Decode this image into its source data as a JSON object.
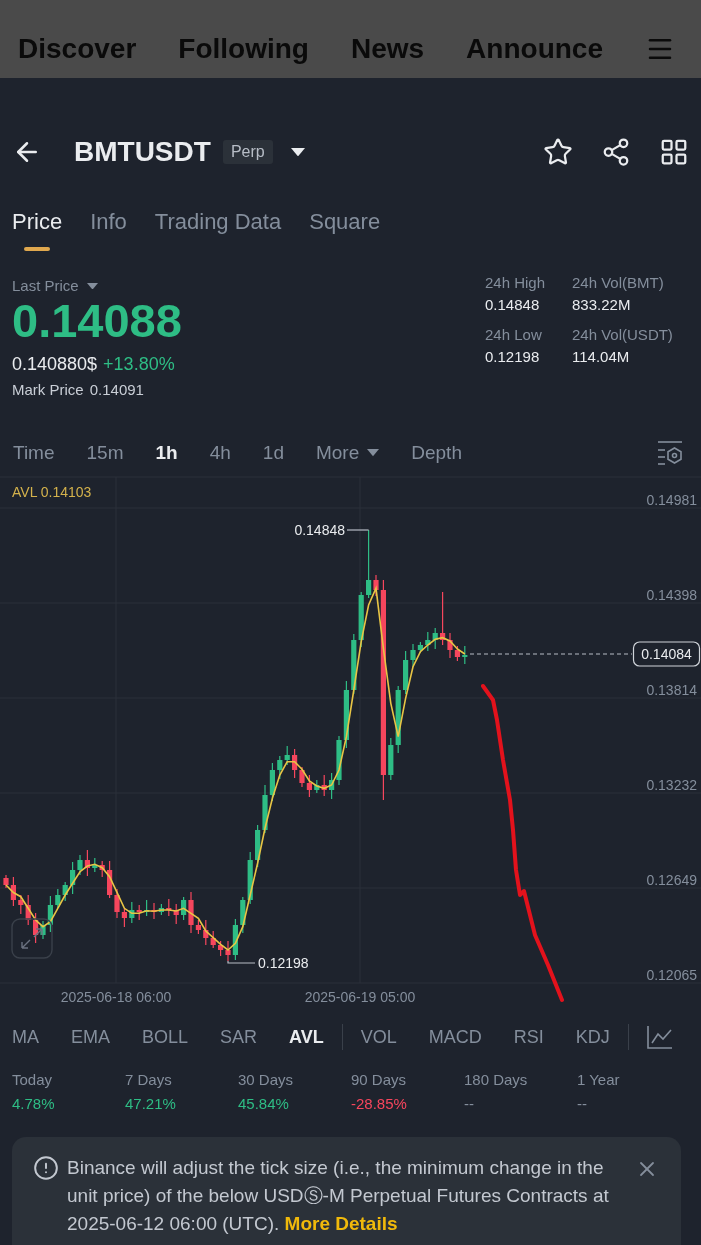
{
  "background_tabs": [
    {
      "label": "Discover"
    },
    {
      "label": "Following"
    },
    {
      "label": "News"
    },
    {
      "label": "Announce"
    }
  ],
  "header": {
    "symbol": "BMTUSDT",
    "badge": "Perp"
  },
  "tabs": [
    {
      "label": "Price",
      "selected": true
    },
    {
      "label": "Info",
      "selected": false
    },
    {
      "label": "Trading Data",
      "selected": false
    },
    {
      "label": "Square",
      "selected": false
    }
  ],
  "price_summary": {
    "last_price_label": "Last Price",
    "last_price": "0.14088",
    "usd_price": "0.140880$",
    "change": "+13.80%",
    "mark_price_label": "Mark Price",
    "mark_price": "0.14091"
  },
  "stats": [
    {
      "label": "24h High",
      "value": "0.14848"
    },
    {
      "label": "24h Vol(BMT)",
      "value": "833.22M"
    },
    {
      "label": "24h Low",
      "value": "0.12198"
    },
    {
      "label": "24h Vol(USDT)",
      "value": "114.04M"
    }
  ],
  "intervals": [
    {
      "label": "Time",
      "kind": "option",
      "selected": false
    },
    {
      "label": "15m",
      "kind": "option",
      "selected": false
    },
    {
      "label": "1h",
      "kind": "option",
      "selected": true
    },
    {
      "label": "4h",
      "kind": "option",
      "selected": false
    },
    {
      "label": "1d",
      "kind": "option",
      "selected": false
    },
    {
      "label": "More",
      "kind": "dropdown",
      "selected": false
    },
    {
      "label": "Depth",
      "kind": "option",
      "selected": false
    }
  ],
  "chart": {
    "indicator_value": "AVL 0.14103",
    "price_ticks": [
      "0.14981",
      "0.14398",
      "0.13814",
      "0.13232",
      "0.12649",
      "0.12065"
    ],
    "time_labels": [
      "2025-06-18 06:00",
      "2025-06-19 05:00"
    ],
    "high_marker": "0.14848",
    "low_marker": "0.12198",
    "current_price": "0.14084"
  },
  "main_indicators": [
    {
      "label": "MA",
      "selected": false
    },
    {
      "label": "EMA",
      "selected": false
    },
    {
      "label": "BOLL",
      "selected": false
    },
    {
      "label": "SAR",
      "selected": false
    },
    {
      "label": "AVL",
      "selected": true
    }
  ],
  "sub_indicators": [
    {
      "label": "VOL",
      "selected": false
    },
    {
      "label": "MACD",
      "selected": false
    },
    {
      "label": "RSI",
      "selected": false
    },
    {
      "label": "KDJ",
      "selected": false
    }
  ],
  "returns": [
    {
      "period": "Today",
      "value": "4.78%",
      "color": "#2ebd85"
    },
    {
      "period": "7 Days",
      "value": "47.21%",
      "color": "#2ebd85"
    },
    {
      "period": "30 Days",
      "value": "45.84%",
      "color": "#2ebd85"
    },
    {
      "period": "90 Days",
      "value": "-28.85%",
      "color": "#f6465d"
    },
    {
      "period": "180 Days",
      "value": "--",
      "color": "#848e9c"
    },
    {
      "period": "1 Year",
      "value": "--",
      "color": "#848e9c"
    }
  ],
  "notice": {
    "text": "Binance will adjust the tick size (i.e., the minimum change in the unit price) of the below USDⓈ-M Perpetual Futures Contracts at 2025-06-12 06:00 (UTC).",
    "link": "More Details"
  }
}
